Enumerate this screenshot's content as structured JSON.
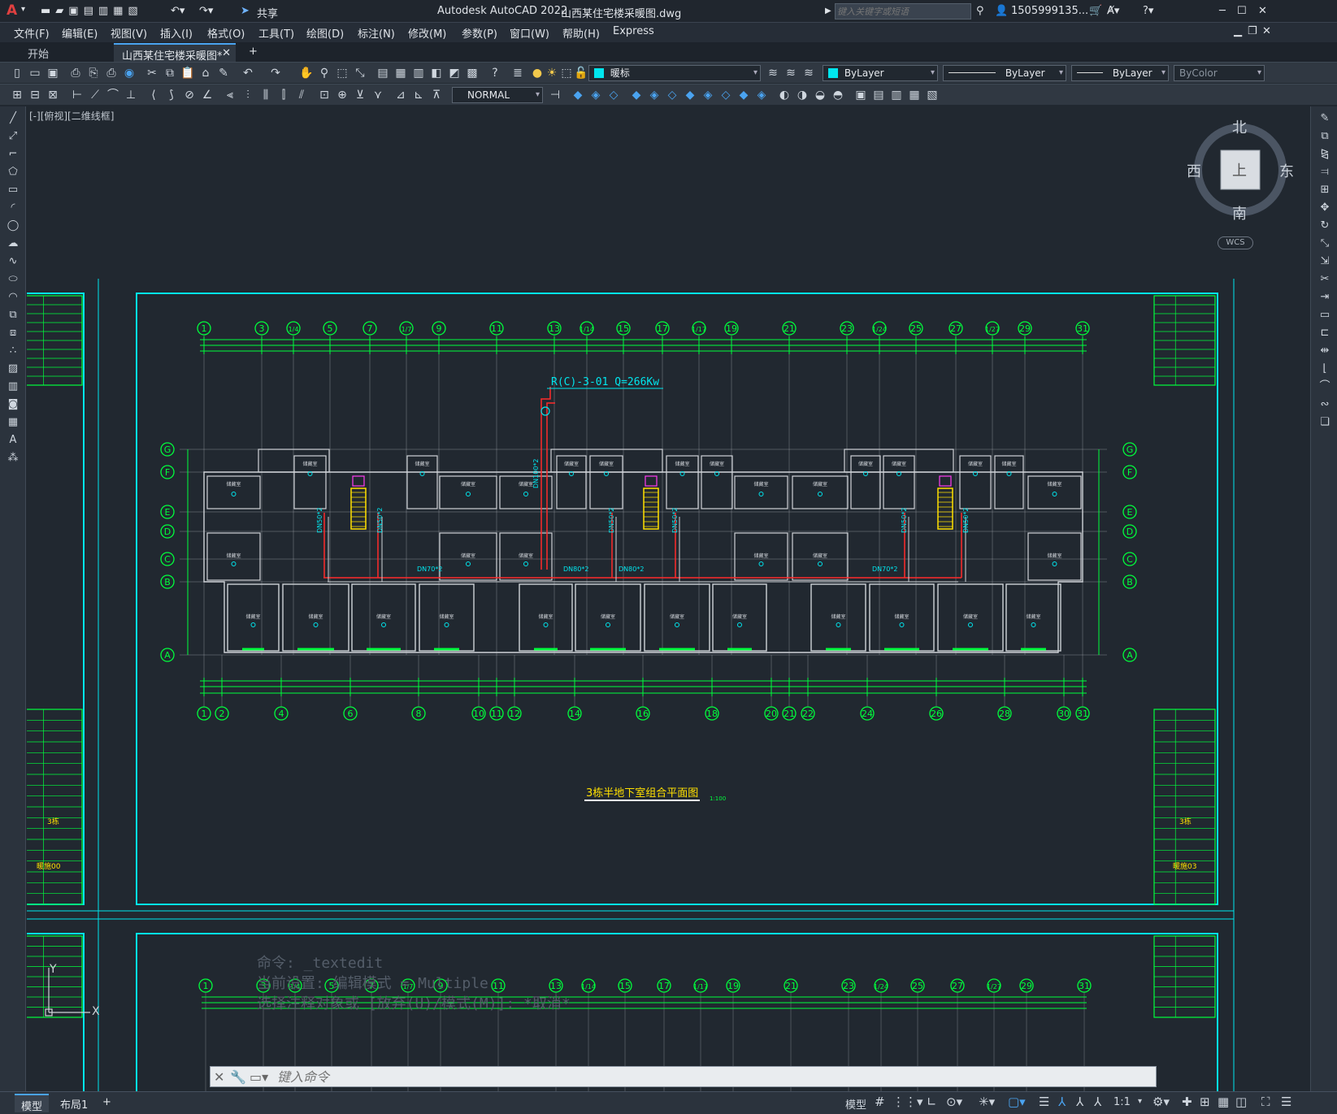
{
  "app": {
    "title": "Autodesk AutoCAD 2022",
    "file": "山西某住宅楼采暖图.dwg",
    "share": "共享",
    "search_placeholder": "键入关键字或短语",
    "user": "1505999135...",
    "logo": "A"
  },
  "menu": [
    "文件(F)",
    "编辑(E)",
    "视图(V)",
    "插入(I)",
    "格式(O)",
    "工具(T)",
    "绘图(D)",
    "标注(N)",
    "修改(M)",
    "参数(P)",
    "窗口(W)",
    "帮助(H)",
    "Express"
  ],
  "tabs": {
    "start": "开始",
    "active": "山西某住宅楼采暖图*",
    "close": "✕",
    "new": "+"
  },
  "props": {
    "layer": "暖标",
    "color": "ByLayer",
    "linetype": "ByLayer",
    "lineweight": "ByLayer",
    "plotstyle": "ByColor",
    "dimstyle": "NORMAL"
  },
  "viewport_label": "[-][俯视][二维线框]",
  "compass": {
    "north": "北",
    "south": "南",
    "east": "东",
    "west": "西",
    "top": "上",
    "wcs": "WCS"
  },
  "drawing": {
    "title": "3栋半地下室组合平面图",
    "scale": "1:100",
    "pipe_label": "R(C)-3-01  Q=266Kw",
    "top_axes": [
      "1",
      "3",
      "1/4",
      "5",
      "7",
      "1/7",
      "9",
      "11",
      "13",
      "1/14",
      "15",
      "17",
      "1/17",
      "19",
      "21",
      "23",
      "1/24",
      "25",
      "27",
      "1/27",
      "29",
      "31"
    ],
    "bottom_axes": [
      "1",
      "2",
      "4",
      "6",
      "8",
      "10",
      "11",
      "12",
      "14",
      "16",
      "18",
      "20",
      "21",
      "22",
      "24",
      "26",
      "28",
      "30",
      "31"
    ],
    "row_axes": [
      "G",
      "F",
      "E",
      "D",
      "C",
      "B",
      "A"
    ],
    "room": "储藏室",
    "pipes": [
      "DN70*2",
      "DN80*2",
      "DN80*2",
      "DN70*2",
      "DN50*2",
      "DN50*2",
      "DN50*2",
      "DN50*2",
      "DN50*2",
      "DN50*2",
      "DN100*2"
    ],
    "title_block_notes": [
      "3栋",
      "暖施00",
      "3栋",
      "暖施03"
    ]
  },
  "command": {
    "history": [
      "命令: _textedit",
      "当前设置: 编辑模式 = Multiple",
      "选择注释对象或 [放弃(U)/模式(M)]: *取消*"
    ],
    "placeholder": "键入命令"
  },
  "layout_tabs": {
    "model": "模型",
    "layout1": "布局1",
    "add": "+"
  },
  "status": {
    "model": "模型",
    "scale": "1:1"
  },
  "colors": {
    "green": "#00ff3c",
    "cyan": "#00e6ee",
    "red": "#ff2a2a",
    "yellow": "#ffe000",
    "magenta": "#ff3cf0",
    "gray": "#cfd3d8"
  }
}
